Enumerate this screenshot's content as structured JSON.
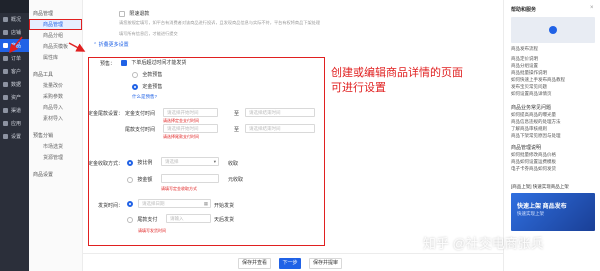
{
  "nav": {
    "items": [
      {
        "label": "概况",
        "icon": "overview-icon"
      },
      {
        "label": "店铺",
        "icon": "store-icon"
      },
      {
        "label": "商品",
        "icon": "goods-icon",
        "active": true
      },
      {
        "label": "订单",
        "icon": "order-icon"
      },
      {
        "label": "客户",
        "icon": "customer-icon"
      },
      {
        "label": "数据",
        "icon": "data-icon"
      },
      {
        "label": "资产",
        "icon": "asset-icon"
      },
      {
        "label": "渠道",
        "icon": "channel-icon"
      },
      {
        "label": "应用",
        "icon": "app-icon"
      },
      {
        "label": "设置",
        "icon": "settings-icon"
      }
    ]
  },
  "subnav": {
    "groups": [
      {
        "title": "商品管理",
        "items": [
          "商品管理",
          "商品分组",
          "商品页模板",
          "属性库"
        ]
      },
      {
        "title": "商品工具",
        "items": [
          "批量改价",
          "采购参数",
          "商品导入",
          "素材导入"
        ]
      },
      {
        "title": "预售分销",
        "items": [
          "市场选货",
          "货源管理"
        ]
      }
    ],
    "top": "商品管理",
    "bottom": "商品设置"
  },
  "form": {
    "top_checkbox": "限速退款",
    "top_note": "请您按规定填写，如平台有消费者对该商品进行投诉，且发现商品信息与实际不符，平台有权将商品下架处理",
    "top_note2": "填写所有信息后，才能进行提交",
    "collapse_link": "折叠更多设置",
    "presale": {
      "label": "预售：",
      "checkbox": "下单后超过时间才能发货",
      "options": [
        "全款预售",
        "定金预售"
      ],
      "help_link": "什么是预售?"
    },
    "deposit_time": {
      "label": "定金尾款设置：",
      "row1_label": "定金支付时间",
      "row2_label": "尾款支付时间",
      "start_placeholder": "请选择开始时间",
      "end_placeholder": "请选择结束时间",
      "to": "至",
      "hint1": "请选择定金支付时间",
      "hint2": "请选择尾款支付时间"
    },
    "deposit_method": {
      "label": "定金收取方式：",
      "option1": "按比例",
      "select_placeholder": "请选择",
      "suffix1": "收取",
      "option2": "按金额",
      "suffix2": "元收取",
      "hint": "请填写定金收取方式"
    },
    "ship_time": {
      "label": "发货时间：",
      "date_placeholder": "请选择日期",
      "suffix1": "开始发货",
      "option2": "尾款支付",
      "num_placeholder": "请输入",
      "suffix2": "天后发货",
      "hint": "请填写发货时间"
    }
  },
  "footer": {
    "left_btn": "保存并查看",
    "mid_btn": "下一步",
    "right_btn": "保存并提审"
  },
  "annotation": "创建或编辑商品详情的页面\n可进行设置",
  "help_panel": {
    "title": "帮助和服务",
    "video_title": "商品发布流程",
    "links": [
      "商品定价说明",
      "商品分组设置",
      "商品批量操作说明",
      "如何快速上手发布商品教程",
      "发布宝贝常见问题",
      "如何设置商品详情页"
    ],
    "sections": [
      {
        "title": "商品业务常见问题",
        "items": [
          "如何提高商品的曝光量",
          "商品信息违规的处理方法",
          "了解商品审核规则",
          "商品下架常见原因与处理"
        ]
      },
      {
        "title": "商品管理说明",
        "items": [
          "如何批量修改商品价格",
          "商品如何设置运费模板",
          "电子卡券商品如何发货"
        ]
      }
    ],
    "ad_title": "[商品上架] 快速实现商品上架",
    "ad_sub": "快速实现上架",
    "ad_banner": "快速上架 商品发布"
  },
  "watermark": "知乎 @社交电商张兵"
}
